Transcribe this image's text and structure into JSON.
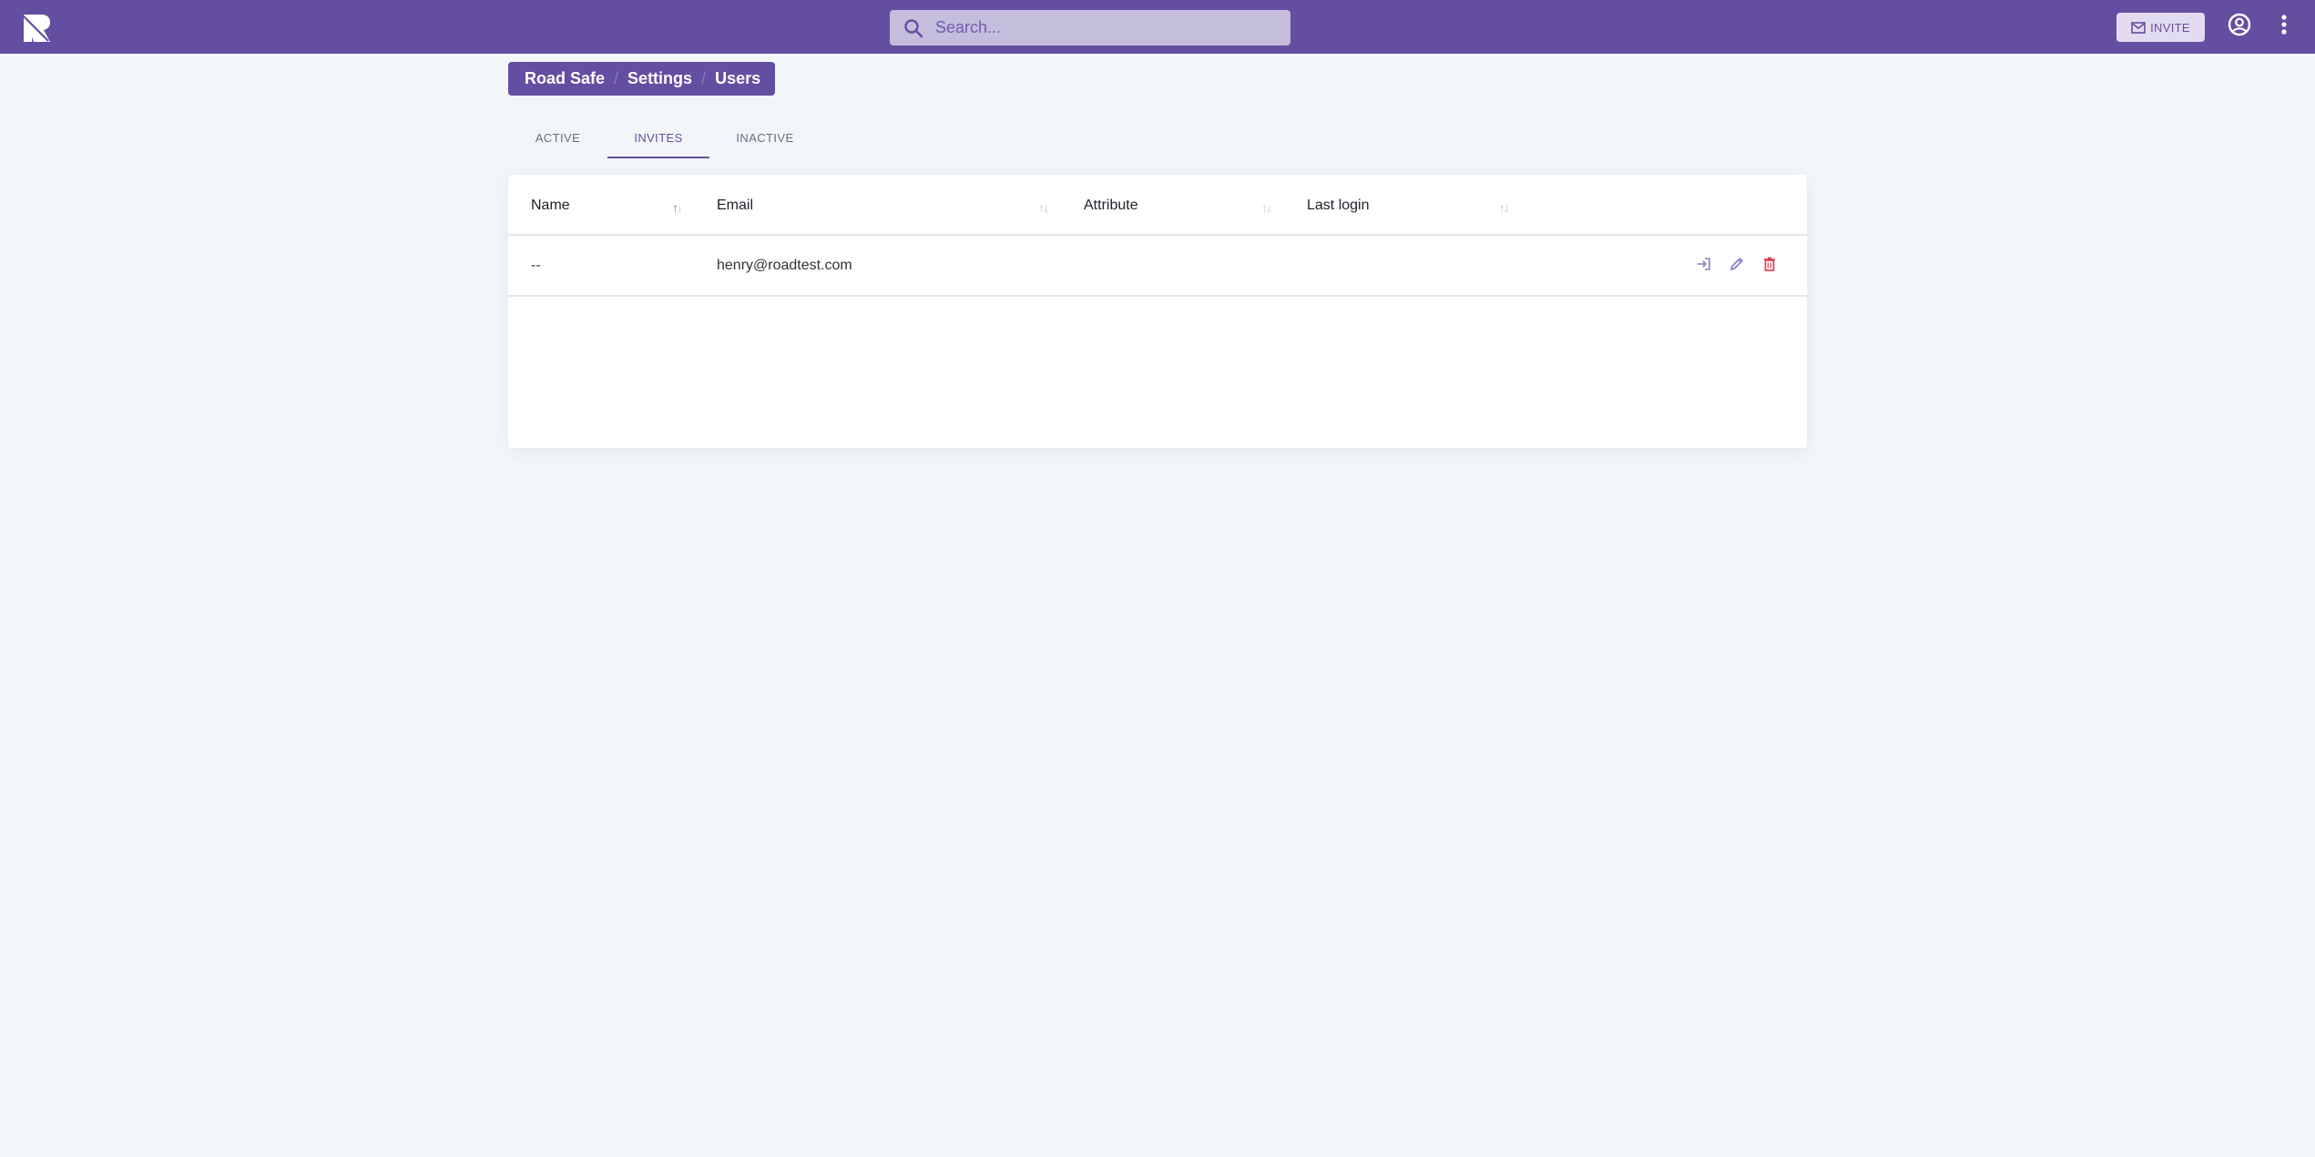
{
  "header": {
    "search": {
      "placeholder": "Search..."
    },
    "invite_label": "INVITE",
    "brand_color": "#644ea1"
  },
  "breadcrumb": [
    "Road Safe",
    "Settings",
    "Users"
  ],
  "tabs": [
    {
      "label": "ACTIVE",
      "active": false
    },
    {
      "label": "INVITES",
      "active": true
    },
    {
      "label": "INACTIVE",
      "active": false
    }
  ],
  "table": {
    "columns": [
      {
        "label": "Name",
        "sort": "asc"
      },
      {
        "label": "Email",
        "sort": "none"
      },
      {
        "label": "Attribute",
        "sort": "none"
      },
      {
        "label": "Last login",
        "sort": "none"
      }
    ],
    "rows": [
      {
        "name": "--",
        "email": "henry@roadtest.com",
        "attribute": "",
        "last_login": ""
      }
    ],
    "row_actions": [
      "login-as-icon",
      "edit-icon",
      "delete-icon"
    ],
    "delete_color": "#e0405a"
  }
}
